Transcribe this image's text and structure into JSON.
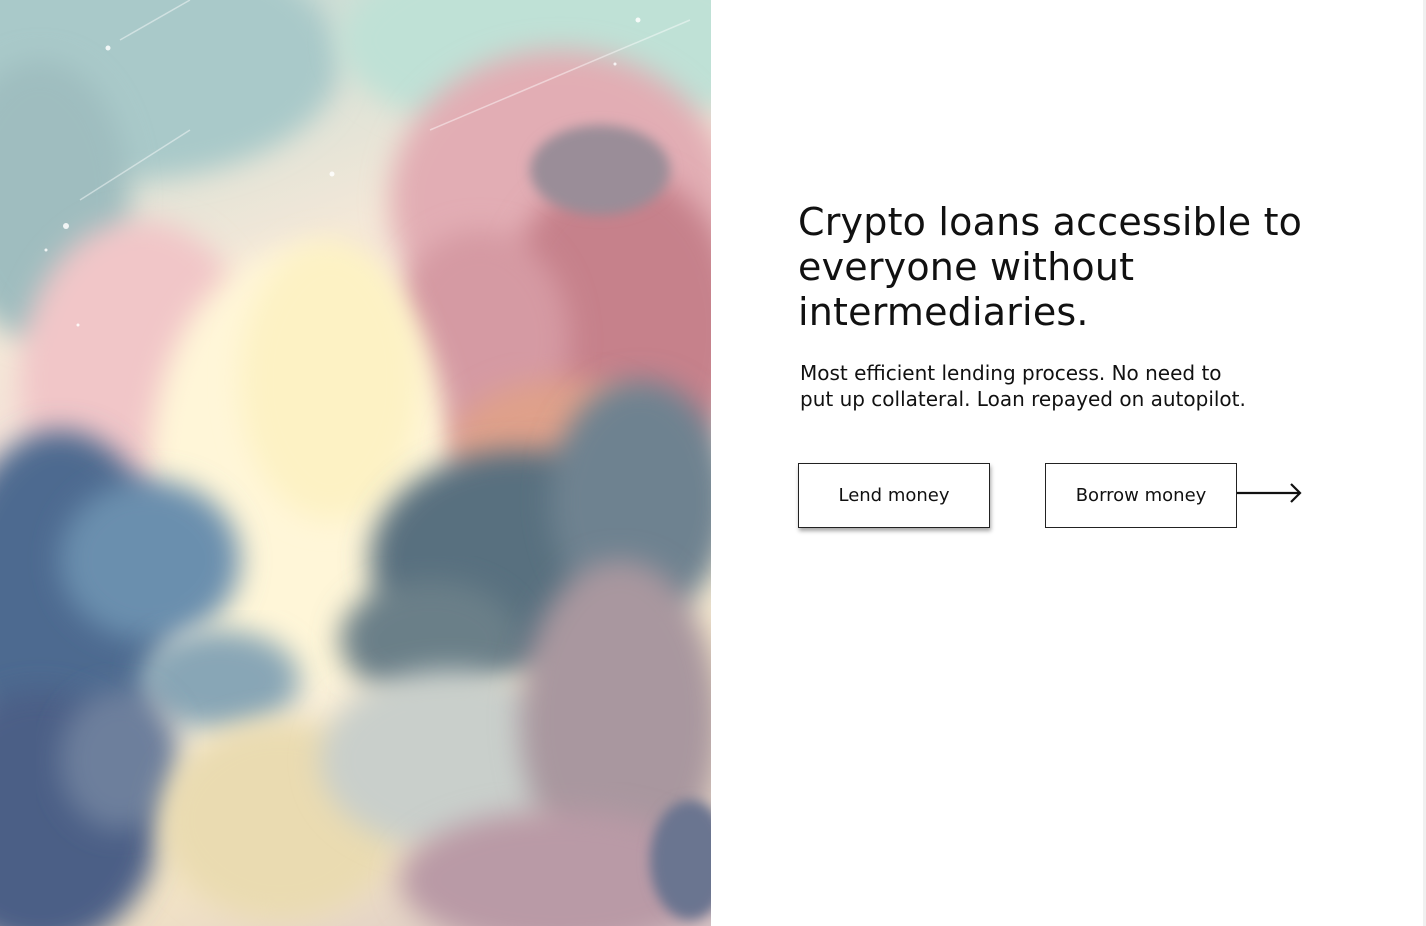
{
  "hero": {
    "headline": "Crypto loans accessible to everyone without intermediaries.",
    "subtext": "Most efficient lending process. No need to put up collateral. Loan repayed on autopilot."
  },
  "actions": {
    "lend_label": "Lend money",
    "borrow_label": "Borrow money",
    "arrow_icon": "arrow-right-icon"
  },
  "artwork": {
    "description_icon": "abstract-painting",
    "palette": [
      "#bcd9d4",
      "#f6dcd9",
      "#fff7e6",
      "#5b6f8c",
      "#c98f95",
      "#e9d6a8"
    ]
  }
}
